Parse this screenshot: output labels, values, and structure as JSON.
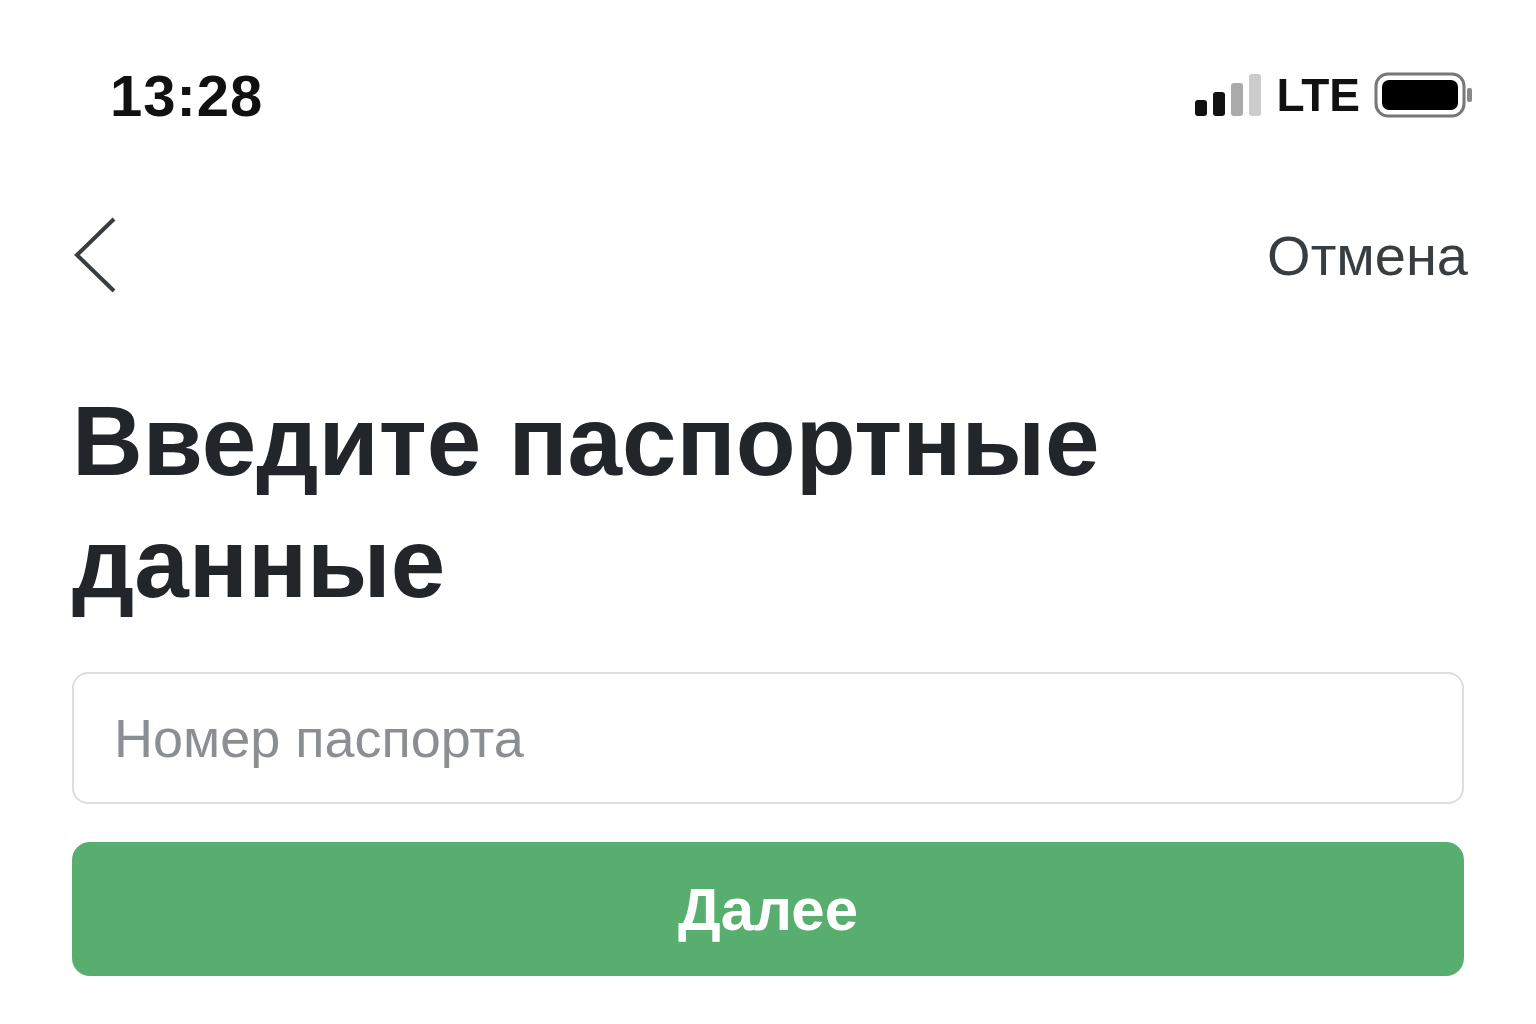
{
  "status_bar": {
    "time": "13:28",
    "network": "LTE"
  },
  "nav": {
    "cancel": "Отмена"
  },
  "title": "Введите паспортные данные",
  "passport_field": {
    "placeholder": "Номер паспорта"
  },
  "next_button": {
    "label": "Далее"
  }
}
